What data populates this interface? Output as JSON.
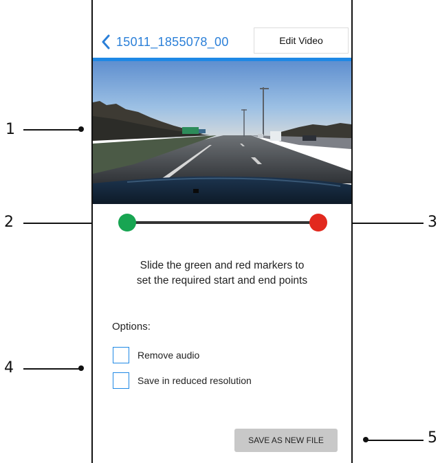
{
  "header": {
    "filename": "15011_1855078_00",
    "edit_button": "Edit Video"
  },
  "editor": {
    "instructions_line1": "Slide the green and red markers to",
    "instructions_line2": "set the required start and end points",
    "options_label": "Options:",
    "options": [
      {
        "label": "Remove audio",
        "checked": false
      },
      {
        "label": "Save in reduced resolution",
        "checked": false
      }
    ],
    "save_button": "SAVE AS NEW FILE",
    "start_marker_color": "#18a552",
    "end_marker_color": "#e2291e",
    "accent_color": "#1e88e5"
  },
  "callouts": [
    "1",
    "2",
    "3",
    "4",
    "5"
  ]
}
